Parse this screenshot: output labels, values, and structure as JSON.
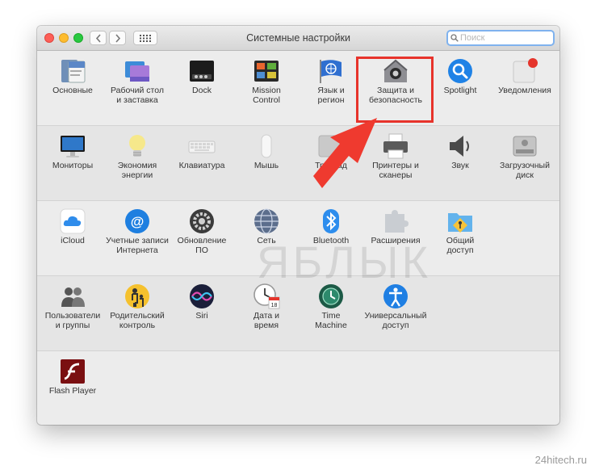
{
  "window": {
    "title": "Системные настройки"
  },
  "search": {
    "placeholder": "Поиск"
  },
  "rows": [
    {
      "items": [
        {
          "name": "general-pane",
          "icon": "general-icon",
          "label": "Основные"
        },
        {
          "name": "desktop-pane",
          "icon": "desktop-screensaver-icon",
          "label": "Рабочий стол\nи заставка"
        },
        {
          "name": "dock-pane",
          "icon": "dock-icon",
          "label": "Dock"
        },
        {
          "name": "mission-control-pane",
          "icon": "mission-control-icon",
          "label": "Mission\nControl"
        },
        {
          "name": "language-pane",
          "icon": "flag-icon",
          "label": "Язык и\nрегион"
        },
        {
          "name": "security-pane",
          "icon": "house-lock-icon",
          "label": "Защита и\nбезопасность"
        },
        {
          "name": "spotlight-pane",
          "icon": "spotlight-icon",
          "label": "Spotlight"
        },
        {
          "name": "notifications-pane",
          "icon": "notifications-icon",
          "label": "Уведомления"
        }
      ]
    },
    {
      "items": [
        {
          "name": "displays-pane",
          "icon": "monitor-icon",
          "label": "Мониторы"
        },
        {
          "name": "energy-pane",
          "icon": "bulb-icon",
          "label": "Экономия\nэнергии"
        },
        {
          "name": "keyboard-pane",
          "icon": "keyboard-icon",
          "label": "Клавиатура"
        },
        {
          "name": "mouse-pane",
          "icon": "mouse-icon",
          "label": "Мышь"
        },
        {
          "name": "trackpad-pane",
          "icon": "trackpad-icon",
          "label": "Трекпад"
        },
        {
          "name": "printers-pane",
          "icon": "printer-icon",
          "label": "Принтеры и\nсканеры"
        },
        {
          "name": "sound-pane",
          "icon": "speaker-icon",
          "label": "Звук"
        },
        {
          "name": "startup-disk-pane",
          "icon": "disk-icon",
          "label": "Загрузочный\nдиск"
        }
      ]
    },
    {
      "items": [
        {
          "name": "icloud-pane",
          "icon": "cloud-icon",
          "label": "iCloud"
        },
        {
          "name": "internet-accounts-pane",
          "icon": "at-icon",
          "label": "Учетные записи\nИнтернета"
        },
        {
          "name": "software-update-pane",
          "icon": "gear-icon",
          "label": "Обновление\nПО"
        },
        {
          "name": "network-pane",
          "icon": "globe-icon",
          "label": "Сеть"
        },
        {
          "name": "bluetooth-pane",
          "icon": "bluetooth-icon",
          "label": "Bluetooth"
        },
        {
          "name": "extensions-pane",
          "icon": "puzzle-icon",
          "label": "Расширения"
        },
        {
          "name": "sharing-pane",
          "icon": "sharing-folder-icon",
          "label": "Общий\nдоступ"
        }
      ]
    },
    {
      "items": [
        {
          "name": "users-pane",
          "icon": "users-icon",
          "label": "Пользователи\nи группы"
        },
        {
          "name": "parental-pane",
          "icon": "parental-icon",
          "label": "Родительский\nконтроль"
        },
        {
          "name": "siri-pane",
          "icon": "siri-icon",
          "label": "Siri"
        },
        {
          "name": "date-time-pane",
          "icon": "clock-calendar-icon",
          "label": "Дата и\nвремя"
        },
        {
          "name": "time-machine-pane",
          "icon": "time-machine-icon",
          "label": "Time\nMachine"
        },
        {
          "name": "accessibility-pane",
          "icon": "accessibility-icon",
          "label": "Универсальный\nдоступ"
        }
      ]
    },
    {
      "items": [
        {
          "name": "flash-player-pane",
          "icon": "flash-icon",
          "label": "Flash Player"
        }
      ]
    }
  ],
  "watermark": "ЯБЛЫК",
  "credit": "24hitech.ru",
  "colors": {
    "highlight": "#e7332b",
    "search_focus": "#7fb2ee"
  }
}
